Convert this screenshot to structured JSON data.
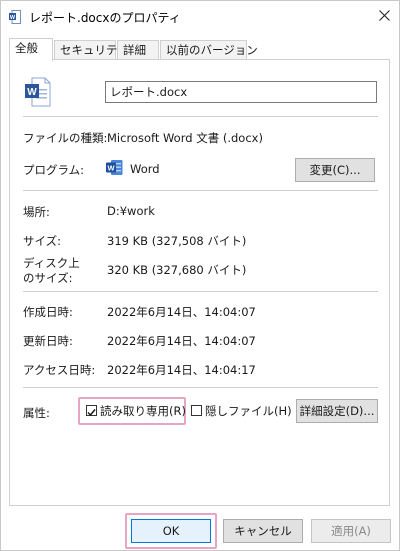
{
  "window": {
    "title": "レポート.docxのプロパティ"
  },
  "tabs": [
    {
      "label": "全般"
    },
    {
      "label": "セキュリティ"
    },
    {
      "label": "詳細"
    },
    {
      "label": "以前のバージョン"
    }
  ],
  "general": {
    "file_name": "レポート.docx",
    "file_type": {
      "label": "ファイルの種類:",
      "value": "Microsoft Word 文書 (.docx)"
    },
    "program": {
      "label": "プログラム:",
      "value": "Word",
      "change_button": "変更(C)..."
    },
    "location": {
      "label": "場所:",
      "value": "D:¥work"
    },
    "size": {
      "label": "サイズ:",
      "value": "319 KB (327,508 バイト)"
    },
    "size_on_disk": {
      "label_line1": "ディスク上",
      "label_line2": "のサイズ:",
      "value": "320 KB (327,680 バイト)"
    },
    "created": {
      "label": "作成日時:",
      "value": "2022年6月14日、14:04:07"
    },
    "modified": {
      "label": "更新日時:",
      "value": "2022年6月14日、14:04:07"
    },
    "accessed": {
      "label": "アクセス日時:",
      "value": "2022年6月14日、14:04:17"
    },
    "attributes": {
      "label": "属性:",
      "readonly_label": "読み取り専用(R)",
      "readonly_checked": true,
      "hidden_label": "隠しファイル(H)",
      "hidden_checked": false,
      "advanced_button": "詳細設定(D)..."
    }
  },
  "footer": {
    "ok": "OK",
    "cancel": "キャンセル",
    "apply": "適用(A)"
  },
  "colors": {
    "highlight": "#e6a5c4",
    "word_blue": "#2b579a"
  },
  "icons": {
    "title": "word-doc-icon",
    "close": "close-icon",
    "file": "word-file-icon",
    "program": "word-app-icon",
    "check": "checkmark-icon"
  }
}
